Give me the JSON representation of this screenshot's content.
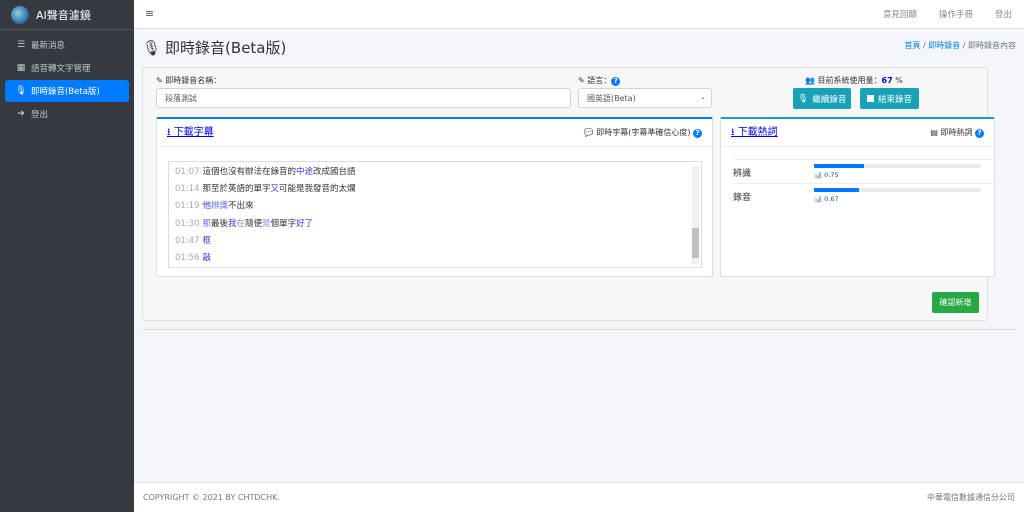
{
  "brand": {
    "name": "AI聲音濾鏡"
  },
  "sidebar": {
    "items": [
      {
        "label": "最新消息",
        "icon": "rss-icon"
      },
      {
        "label": "語音轉文字管理",
        "icon": "grid-icon"
      },
      {
        "label": "即時錄音(Beta版)",
        "icon": "microphone-icon",
        "active": true
      },
      {
        "label": "登出",
        "icon": "sign-out-icon"
      }
    ]
  },
  "topbar": {
    "links": [
      "意見回饋",
      "操作手冊",
      "登出"
    ]
  },
  "page": {
    "title": "即時錄音(Beta版)",
    "breadcrumb": [
      "首頁",
      "即時錄音",
      "即時錄音內容"
    ]
  },
  "form": {
    "name_label": "即時錄音名稱：",
    "name_value": "段落測試",
    "lang_label": "語言：",
    "lang_value": "國英語(Beta)",
    "usage_label": "目前系統使用量：",
    "usage_value": "67",
    "usage_unit": "%",
    "continue_label": "繼續錄音",
    "stop_label": "結束錄音",
    "confirm_label": "確認新增"
  },
  "subtitles": {
    "download_label": "下載字幕",
    "title": "即時字幕(字幕準確信心度)",
    "lines": [
      {
        "time": "01:07",
        "segs": [
          {
            "t": "這個也沒有辦法在錄音的",
            "c": "#333"
          },
          {
            "t": "中途",
            "c": "#3a3ad0"
          },
          {
            "t": "改成國台語",
            "c": "#333"
          }
        ]
      },
      {
        "time": "01:14",
        "segs": [
          {
            "t": "那至於英語的單字",
            "c": "#333"
          },
          {
            "t": "又",
            "c": "#3a3ad0"
          },
          {
            "t": "可能是我發音的太爛",
            "c": "#333"
          }
        ]
      },
      {
        "time": "01:19",
        "segs": [
          {
            "t": "他",
            "c": "#3a3ad0"
          },
          {
            "t": "辨識",
            "c": "#6a6aff"
          },
          {
            "t": "不出來",
            "c": "#333"
          }
        ]
      },
      {
        "time": "01:30",
        "segs": [
          {
            "t": "那",
            "c": "#6a6aff"
          },
          {
            "t": "最後",
            "c": "#333"
          },
          {
            "t": "我",
            "c": "#3a3ad0"
          },
          {
            "t": "在",
            "c": "#8a8aff"
          },
          {
            "t": "隨便",
            "c": "#333"
          },
          {
            "t": "是",
            "c": "#8a8aff"
          },
          {
            "t": "個單字",
            "c": "#333"
          },
          {
            "t": "好了",
            "c": "#3a3ad0"
          }
        ]
      },
      {
        "time": "01:47",
        "segs": [
          {
            "t": "框",
            "c": "#3a3ad0"
          }
        ]
      },
      {
        "time": "01:56",
        "segs": [
          {
            "t": "敲",
            "c": "#3a3ad0"
          }
        ]
      }
    ]
  },
  "hotwords": {
    "download_label": "下載熱詞",
    "title": "即時熱詞",
    "items": [
      {
        "word": "辨識",
        "score": "0.75",
        "fill_percent": 30
      },
      {
        "word": "錄音",
        "score": "0.67",
        "fill_percent": 27
      }
    ]
  },
  "footer": {
    "copyright": "COPYRIGHT © 2021 BY CHTDCHK.",
    "company": "中華電信數據通信分公司"
  }
}
